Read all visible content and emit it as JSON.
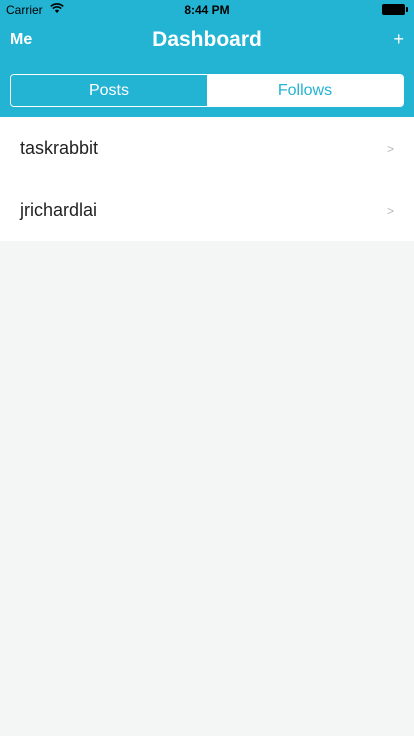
{
  "status_bar": {
    "carrier": "Carrier",
    "time": "8:44 PM"
  },
  "nav": {
    "left_label": "Me",
    "title": "Dashboard",
    "right_label": "+"
  },
  "segments": [
    {
      "label": "Posts",
      "selected": true
    },
    {
      "label": "Follows",
      "selected": false
    }
  ],
  "follows": [
    {
      "name": "taskrabbit",
      "chevron": ">"
    },
    {
      "name": "jrichardlai",
      "chevron": ">"
    }
  ],
  "colors": {
    "accent": "#23b3d3",
    "background": "#f4f5f5"
  }
}
